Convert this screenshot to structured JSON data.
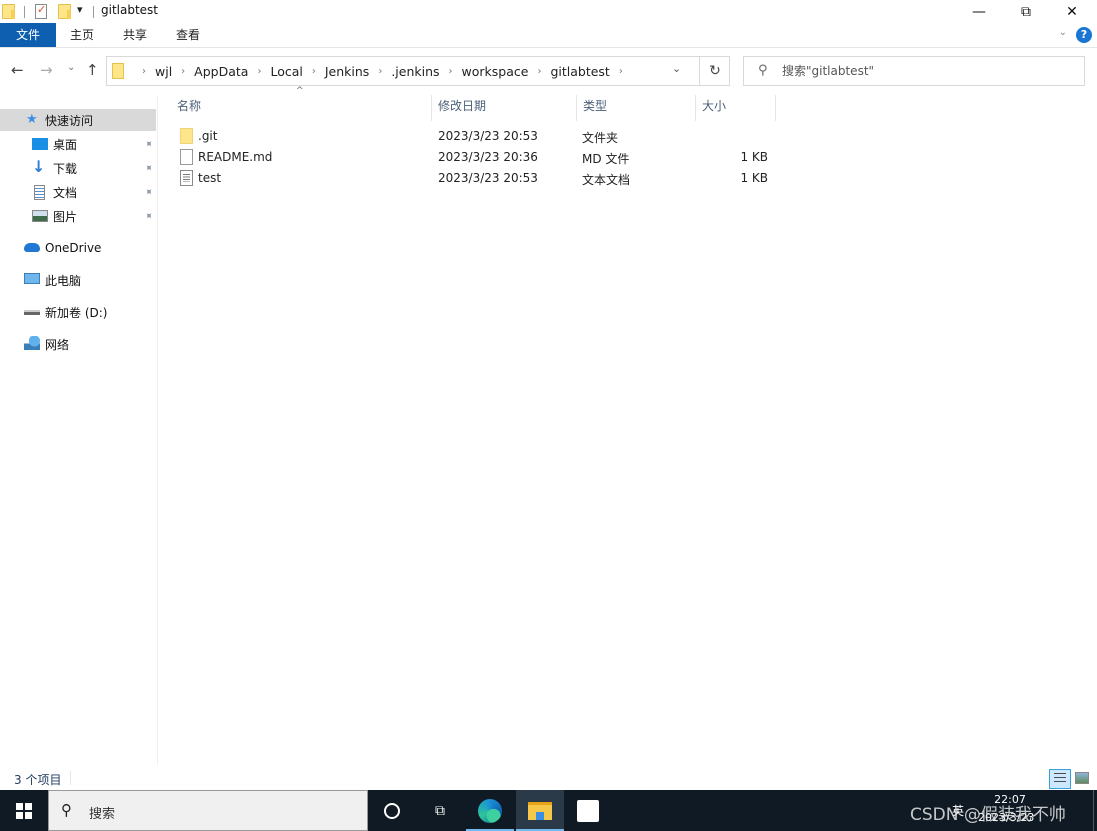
{
  "window": {
    "title": "gitlabtest",
    "controls": {
      "minimize": "—",
      "maximize": "⧉",
      "close": "✕"
    }
  },
  "quick_access_toolbar": {
    "icons": [
      "folder-icon",
      "properties-icon",
      "new-folder-icon",
      "customize-dropdown-icon"
    ],
    "dropdown_glyph": "▾"
  },
  "ribbon": {
    "tabs": [
      {
        "label": "文件",
        "active": true
      },
      {
        "label": "主页"
      },
      {
        "label": "共享"
      },
      {
        "label": "查看"
      }
    ],
    "collapse_glyph": "⌄",
    "help_glyph": "?"
  },
  "navigation": {
    "back": "←",
    "forward": "→",
    "recent": "⌄",
    "up": "↑",
    "breadcrumb": [
      "wjl",
      "AppData",
      "Local",
      "Jenkins",
      ".jenkins",
      "workspace",
      "gitlabtest"
    ],
    "separator": "›",
    "dropdown_glyph": "⌄",
    "refresh_glyph": "↻",
    "search_placeholder": "搜索\"gitlabtest\"",
    "search_glyph": "⚲"
  },
  "sidebar": {
    "items": [
      {
        "label": "快速访问",
        "icon": "star-icon",
        "active": true
      },
      {
        "label": "桌面",
        "icon": "desktop-icon",
        "pinned": true
      },
      {
        "label": "下载",
        "icon": "download-icon",
        "pinned": true
      },
      {
        "label": "文档",
        "icon": "documents-icon",
        "pinned": true
      },
      {
        "label": "图片",
        "icon": "pictures-icon",
        "pinned": true
      },
      {
        "label": "OneDrive",
        "icon": "cloud-icon"
      },
      {
        "label": "此电脑",
        "icon": "computer-icon"
      },
      {
        "label": "新加卷 (D:)",
        "icon": "drive-icon"
      },
      {
        "label": "网络",
        "icon": "network-icon"
      }
    ],
    "pin_glyph": "📌"
  },
  "file_list": {
    "columns": [
      "名称",
      "修改日期",
      "类型",
      "大小"
    ],
    "sort_glyph": "^",
    "rows": [
      {
        "name": ".git",
        "modified": "2023/3/23 20:53",
        "type": "文件夹",
        "size": "",
        "icon": "folder-icon"
      },
      {
        "name": "README.md",
        "modified": "2023/3/23 20:36",
        "type": "MD 文件",
        "size": "1 KB",
        "icon": "file-icon"
      },
      {
        "name": "test",
        "modified": "2023/3/23 20:53",
        "type": "文本文档",
        "size": "1 KB",
        "icon": "text-file-icon"
      }
    ]
  },
  "status_bar": {
    "item_count": "3 个项目",
    "views": [
      "details-view",
      "large-icons-view"
    ]
  },
  "taskbar": {
    "search_placeholder": "搜索",
    "search_glyph": "⚲",
    "apps": [
      "cortana",
      "task-view",
      "edge",
      "file-explorer",
      "microsoft-store"
    ],
    "task_view_glyph": "⧉",
    "ime": "英",
    "time": "22:07",
    "date": "2023/3/23",
    "watermark": "CSDN @假装我不帅"
  },
  "colors": {
    "file_tab": "#0f5fb0",
    "selection": "#d9d9d9",
    "header_text": "#4c607a",
    "taskbar": "#0f1a24",
    "accent": "#76b9ed"
  }
}
